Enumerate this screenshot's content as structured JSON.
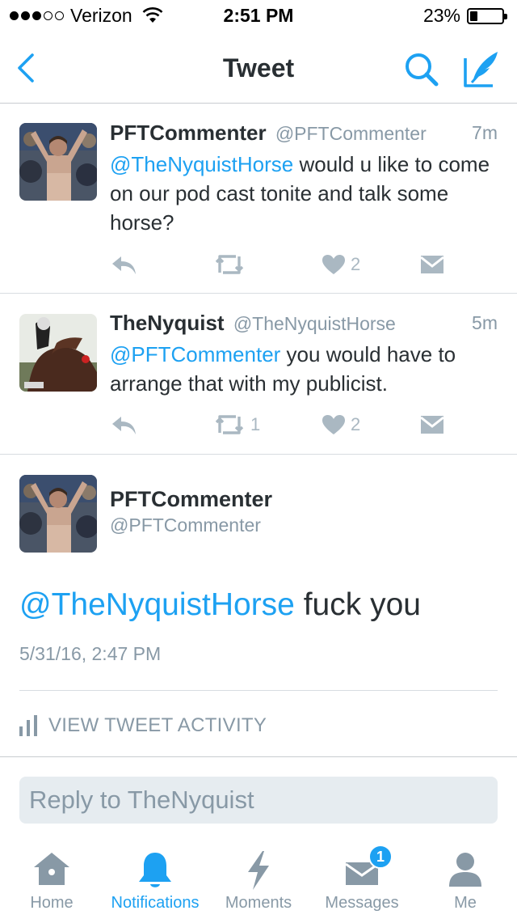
{
  "status_bar": {
    "carrier": "Verizon",
    "time": "2:51 PM",
    "battery": "23%",
    "battery_level": 0.23
  },
  "nav": {
    "title": "Tweet",
    "icons": [
      "back-chevron-icon",
      "search-icon",
      "compose-tweet-icon"
    ]
  },
  "tweets": [
    {
      "name": "PFTCommenter",
      "handle": "@PFTCommenter",
      "time": "7m",
      "mention": "@TheNyquistHorse",
      "text": " would u like to come on our pod cast tonite and talk some horse?",
      "retweets": "",
      "likes": "2"
    },
    {
      "name": "TheNyquist",
      "handle": "@TheNyquistHorse",
      "time": "5m",
      "mention": "@PFTCommenter",
      "text": " you would have to arrange that with my publicist.",
      "retweets": "1",
      "likes": "2"
    }
  ],
  "focused": {
    "name": "PFTCommenter",
    "handle": "@PFTCommenter",
    "mention": "@TheNyquistHorse",
    "text": " fuck you",
    "date": "5/31/16, 2:47 PM",
    "activity_label": "VIEW TWEET ACTIVITY"
  },
  "reply": {
    "placeholder": "Reply to TheNyquist"
  },
  "tabs": [
    {
      "label": "Home",
      "icon": "home-icon"
    },
    {
      "label": "Notifications",
      "icon": "bell-icon",
      "active": true
    },
    {
      "label": "Moments",
      "icon": "lightning-icon"
    },
    {
      "label": "Messages",
      "icon": "envelope-icon",
      "badge": "1"
    },
    {
      "label": "Me",
      "icon": "person-icon"
    }
  ],
  "colors": {
    "accent": "#1da1f2",
    "text": "#292f33",
    "muted": "#8899a6",
    "icon_gray": "#aab8c2"
  }
}
